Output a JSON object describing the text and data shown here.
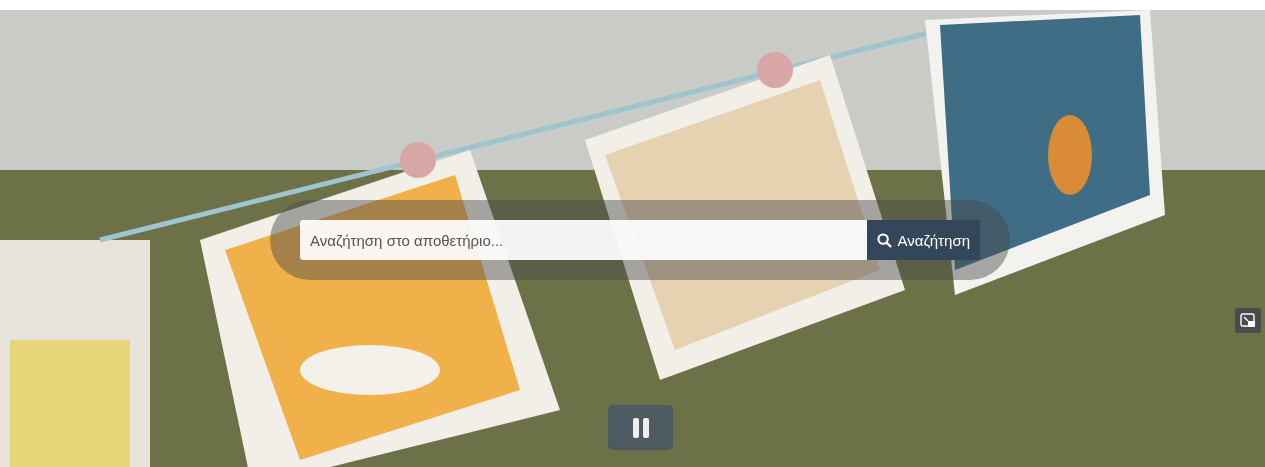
{
  "search": {
    "placeholder": "Αναζήτηση στο αποθετήριο...",
    "button": "Αναζήτηση"
  },
  "slideshow": {
    "playing": true
  }
}
